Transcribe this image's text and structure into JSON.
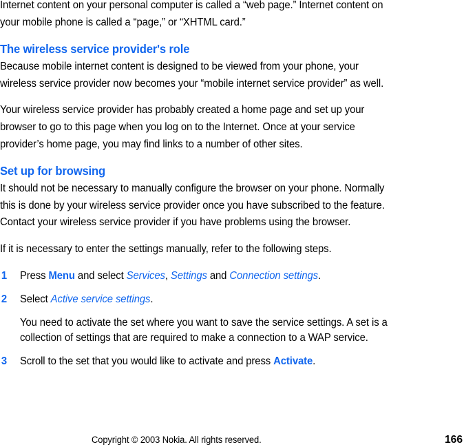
{
  "document": {
    "type": "user-guide-page",
    "accent_color": "#1166ee",
    "text_color": "#000000",
    "background_color": "#ffffff"
  },
  "intro": {
    "paragraph": "Internet content on your personal computer is called a “web page.” Internet content on your mobile phone is called a “page,” or “XHTML card.”"
  },
  "section_provider": {
    "heading": "The wireless service provider's role",
    "paragraph1": "Because mobile internet content is designed to be viewed from your phone, your wireless service provider now becomes your “mobile internet service provider” as well.",
    "paragraph2": "Your wireless service provider has probably created a home page and set up your browser to go to this page when you log on to the Internet. Once at your service provider’s home page, you may find links to a number of other sites."
  },
  "section_setup": {
    "heading": "Set up for browsing",
    "paragraph1": "It should not be necessary to manually configure the browser on your phone. Normally this is done by your wireless service provider once you have subscribed to the feature. Contact your wireless service provider if you have problems using the browser.",
    "paragraph2": "If it is necessary to enter the settings manually, refer to the following steps."
  },
  "steps": {
    "step1": {
      "number": "1",
      "text_before": "Press ",
      "key_label": "Menu",
      "text_mid1": " and select ",
      "menu1": "Services",
      "text_mid2": ", ",
      "menu2": "Settings",
      "text_mid3": " and ",
      "menu3": "Connection settings",
      "text_after": "."
    },
    "step2": {
      "number": "2",
      "text_before": "Select ",
      "menu1": "Active service settings",
      "text_after": ".",
      "note": "You need to activate the set where you want to save the service settings. A set is a collection of settings that are required to make a connection to a WAP service."
    },
    "step3": {
      "number": "3",
      "text_before": "Scroll to the set that you would like to activate and press ",
      "key_label": "Activate",
      "text_after": "."
    }
  },
  "footer": {
    "copyright": "Copyright © 2003 Nokia. All rights reserved.",
    "page_number": "166"
  }
}
